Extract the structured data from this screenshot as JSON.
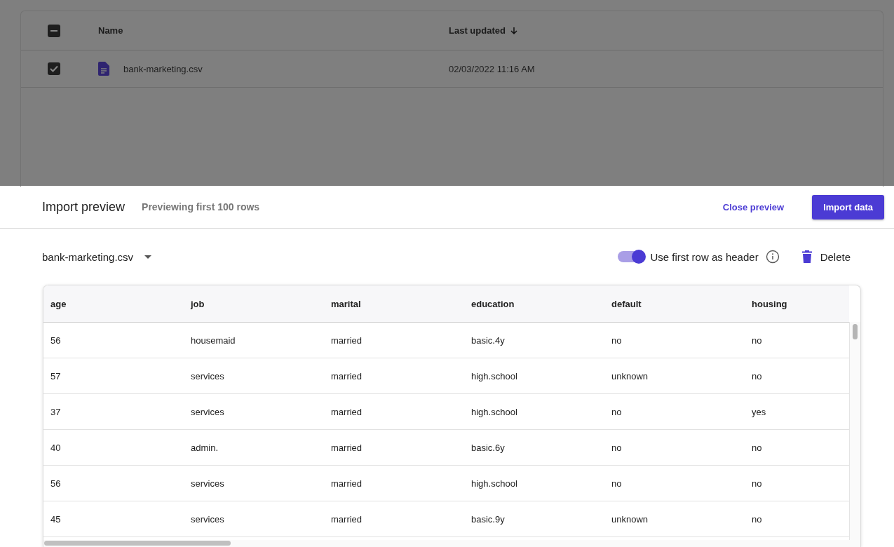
{
  "files_table": {
    "select_all": {
      "indeterminate": true
    },
    "columns": [
      {
        "label": "Name",
        "sorted": false
      },
      {
        "label": "Last updated",
        "sorted": true
      }
    ],
    "rows": [
      {
        "name": "bank-marketing.csv",
        "updated": "02/03/2022 11:16 AM",
        "selected": true
      }
    ]
  },
  "preview": {
    "title": "Import preview",
    "subtitle": "Previewing first 100 rows",
    "close_link": "Close preview",
    "import_button": "Import data",
    "file_select": "bank-marketing.csv",
    "header_toggle": {
      "label": "Use first row as header",
      "on": true
    },
    "delete_button": "Delete",
    "columns": [
      "age",
      "job",
      "marital",
      "education",
      "default",
      "housing"
    ],
    "rows": [
      [
        "56",
        "housemaid",
        "married",
        "basic.4y",
        "no",
        "no"
      ],
      [
        "57",
        "services",
        "married",
        "high.school",
        "unknown",
        "no"
      ],
      [
        "37",
        "services",
        "married",
        "high.school",
        "no",
        "yes"
      ],
      [
        "40",
        "admin.",
        "married",
        "basic.6y",
        "no",
        "no"
      ],
      [
        "56",
        "services",
        "married",
        "high.school",
        "no",
        "no"
      ],
      [
        "45",
        "services",
        "married",
        "basic.9y",
        "unknown",
        "no"
      ]
    ]
  }
}
